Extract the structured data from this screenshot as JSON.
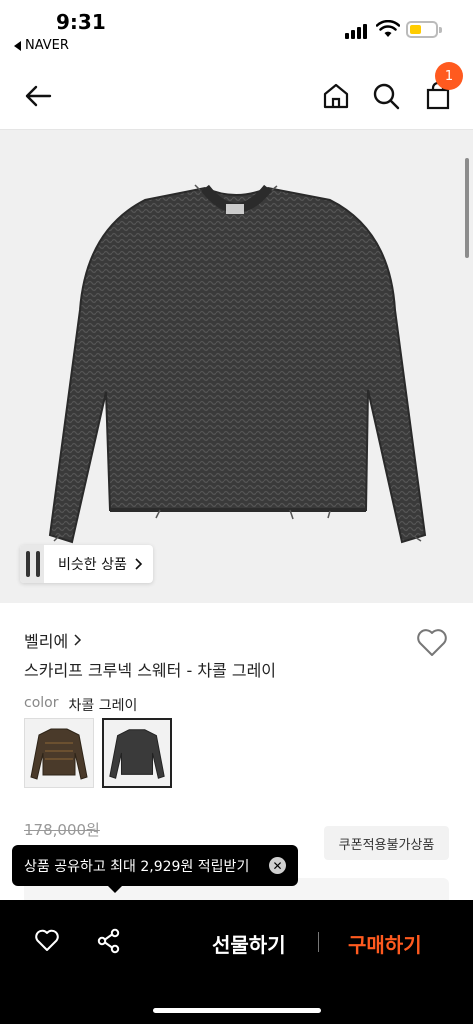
{
  "status_bar": {
    "time": "9:31",
    "back_app": "NAVER"
  },
  "nav": {
    "cart_count": "1",
    "accent": "#ff5a1f"
  },
  "hero": {
    "similar_label": "비슷한 상품"
  },
  "product": {
    "brand": "벨리에",
    "title": "스카리프 크루넥 스웨터 - 차콜 그레이",
    "color_key": "color",
    "color_value": "차콜 그레이",
    "swatches": [
      "brown",
      "charcoal"
    ],
    "price_original": "178,000원",
    "coupon_label": "쿠폰적용불가상품"
  },
  "tooltip": {
    "text": "상품 공유하고 최대 2,929원 적립받기"
  },
  "bottom_bar": {
    "gift_label": "선물하기",
    "buy_label": "구매하기"
  },
  "icons": [
    "back-arrow-icon",
    "home-icon",
    "search-icon",
    "shopping-bag-icon",
    "heart-icon",
    "share-icon",
    "close-icon",
    "chevron-right-icon"
  ]
}
